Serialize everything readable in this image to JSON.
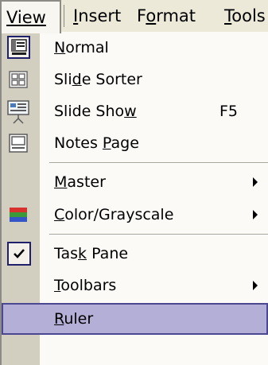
{
  "menubar": {
    "view": "View",
    "insert": "Insert",
    "format": "Format",
    "tools": "Tools"
  },
  "menu": {
    "normal": {
      "pre": "",
      "key": "N",
      "post": "ormal"
    },
    "slide_sorter": {
      "pre": "Sli",
      "key": "d",
      "post": "e Sorter"
    },
    "slide_show": {
      "pre": "Slide Sho",
      "key": "w",
      "post": "",
      "shortcut": "F5"
    },
    "notes_page": {
      "pre": "Notes ",
      "key": "P",
      "post": "age"
    },
    "master": {
      "pre": "",
      "key": "M",
      "post": "aster"
    },
    "color_grayscale": {
      "pre": "",
      "key": "C",
      "post": "olor/Grayscale"
    },
    "task_pane": {
      "pre": "Tas",
      "key": "k",
      "post": " Pane"
    },
    "toolbars": {
      "pre": "",
      "key": "T",
      "post": "oolbars"
    },
    "ruler": {
      "pre": "",
      "key": "R",
      "post": "uler"
    }
  },
  "colors": {
    "gutter": "#d2cfc1",
    "menu_background": "#fbfaf7",
    "selected_background": "#b4afd6",
    "selected_border": "#4b4790"
  }
}
